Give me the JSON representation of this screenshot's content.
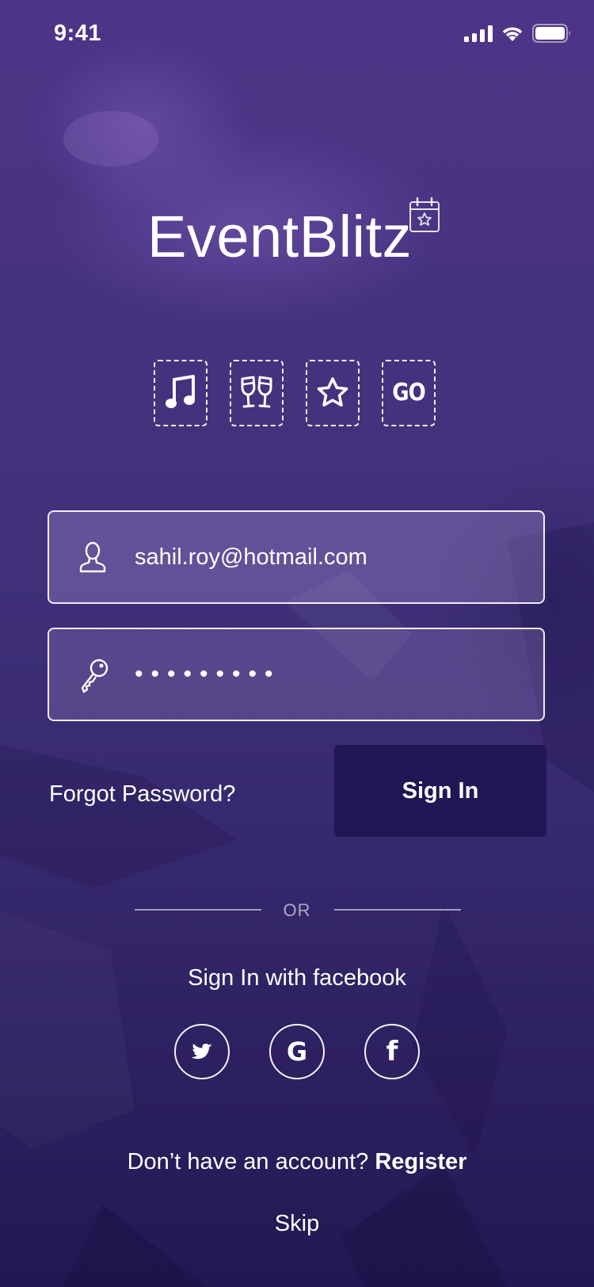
{
  "status_bar": {
    "time": "9:41",
    "signal_icon": "cellular-signal-icon",
    "wifi_icon": "wifi-icon",
    "battery_icon": "battery-icon"
  },
  "app": {
    "name": "EventBlitz",
    "logo_icon": "calendar-star-icon"
  },
  "categories": [
    {
      "icon": "music-note-icon"
    },
    {
      "icon": "toast-glasses-icon"
    },
    {
      "icon": "star-icon"
    },
    {
      "icon": "go-icon",
      "label": "GO"
    }
  ],
  "login": {
    "email_value": "sahil.roy@hotmail.com",
    "email_icon": "user-icon",
    "password_value": "•••••••••",
    "password_icon": "key-icon",
    "forgot_label": "Forgot Password?",
    "signin_label": "Sign In"
  },
  "divider": {
    "label": "OR"
  },
  "social": {
    "facebook_text": "Sign In with facebook",
    "buttons": [
      {
        "icon": "twitter-icon"
      },
      {
        "icon": "google-icon",
        "label": "G"
      },
      {
        "icon": "facebook-icon",
        "label": "f"
      }
    ]
  },
  "footer": {
    "no_account_text": "Don’t have an account?",
    "register_label": "Register",
    "skip_label": "Skip"
  },
  "colors": {
    "background_top": "#4e3487",
    "background_bottom": "#231853",
    "signin_button": "#221656"
  }
}
